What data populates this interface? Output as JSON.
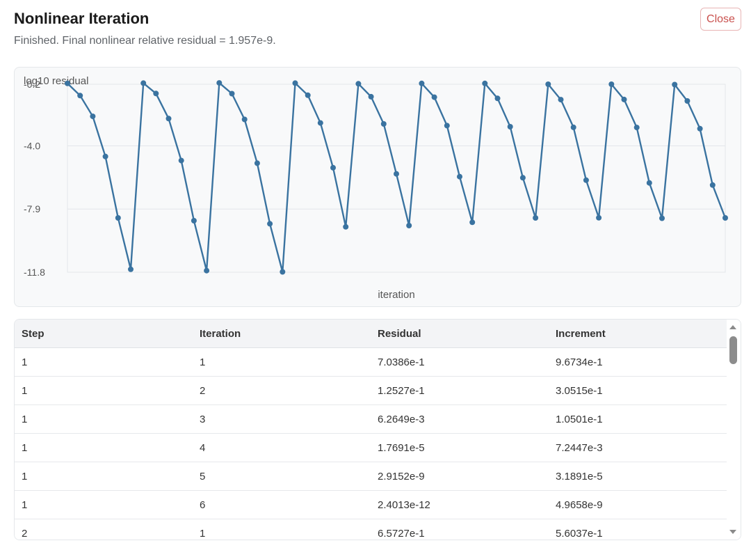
{
  "dialog": {
    "title": "Nonlinear Iteration",
    "status": "Finished. Final nonlinear relative residual = 1.957e-9.",
    "close_label": "Close"
  },
  "chart_data": {
    "type": "line",
    "ylabel": "log10 residual",
    "xlabel": "iteration",
    "ytick_labels": [
      "-0.2",
      "-4.0",
      "-7.9",
      "-11.8"
    ],
    "ytick_values": [
      -0.2,
      -4.0,
      -7.9,
      -11.8
    ],
    "ylim": [
      -11.8,
      -0.2
    ],
    "grid": true,
    "color": "#3a73a0",
    "series": [
      {
        "values": [
          -0.15,
          -0.9,
          -2.18,
          -4.66,
          -8.45,
          -11.62,
          -0.13,
          -0.77,
          -2.32,
          -4.91,
          -8.62,
          -11.7,
          -0.12,
          -0.78,
          -2.37,
          -5.07,
          -8.81,
          -11.78,
          -0.13,
          -0.88,
          -2.59,
          -5.35,
          -9.0,
          -0.17,
          -0.97,
          -2.65,
          -5.73,
          -8.92,
          -0.15,
          -1.0,
          -2.75,
          -5.9,
          -8.72,
          -0.15,
          -1.07,
          -2.82,
          -5.97,
          -8.45,
          -0.2,
          -1.15,
          -2.86,
          -6.12,
          -8.44,
          -0.2,
          -1.14,
          -2.87,
          -6.29,
          -8.47,
          -0.22,
          -1.23,
          -2.94,
          -6.42,
          -8.45
        ]
      }
    ]
  },
  "table": {
    "columns": [
      "Step",
      "Iteration",
      "Residual",
      "Increment"
    ],
    "rows": [
      [
        "1",
        "1",
        "7.0386e-1",
        "9.6734e-1"
      ],
      [
        "1",
        "2",
        "1.2527e-1",
        "3.0515e-1"
      ],
      [
        "1",
        "3",
        "6.2649e-3",
        "1.0501e-1"
      ],
      [
        "1",
        "4",
        "1.7691e-5",
        "7.2447e-3"
      ],
      [
        "1",
        "5",
        "2.9152e-9",
        "3.1891e-5"
      ],
      [
        "1",
        "6",
        "2.4013e-12",
        "4.9658e-9"
      ],
      [
        "2",
        "1",
        "6.5727e-1",
        "5.6037e-1"
      ]
    ]
  }
}
